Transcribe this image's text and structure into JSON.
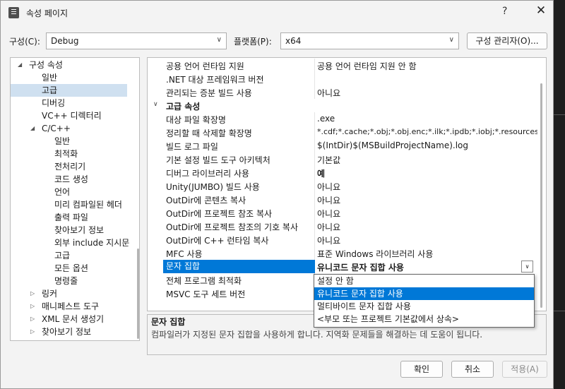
{
  "window": {
    "title": "속성 페이지",
    "help": "?",
    "close": "✕"
  },
  "toolbar": {
    "config_label": "구성(C):",
    "config_value": "Debug",
    "platform_label": "플랫폼(P):",
    "platform_value": "x64",
    "config_manager": "구성 관리자(O)..."
  },
  "tree": {
    "items": [
      {
        "label": "구성 속성",
        "caret": "◢"
      },
      {
        "label": "일반"
      },
      {
        "label": "고급",
        "selected": true
      },
      {
        "label": "디버깅"
      },
      {
        "label": "VC++ 디렉터리"
      },
      {
        "label": "C/C++",
        "caret": "◢"
      },
      {
        "label": "일반"
      },
      {
        "label": "최적화"
      },
      {
        "label": "전처리기"
      },
      {
        "label": "코드 생성"
      },
      {
        "label": "언어"
      },
      {
        "label": "미리 컴파일된 헤더"
      },
      {
        "label": "출력 파일"
      },
      {
        "label": "찾아보기 정보"
      },
      {
        "label": "외부 include 지시문"
      },
      {
        "label": "고급"
      },
      {
        "label": "모든 옵션"
      },
      {
        "label": "명령줄"
      },
      {
        "label": "링커",
        "caret": "▷"
      },
      {
        "label": "매니페스트 도구",
        "caret": "▷"
      },
      {
        "label": "XML 문서 생성기",
        "caret": "▷"
      },
      {
        "label": "찾아보기 정보",
        "caret": "▷"
      }
    ]
  },
  "grid": {
    "rows": [
      {
        "name": "공용 언어 런타임 지원",
        "value": "공용 언어 런타임 지원 안 함"
      },
      {
        "name": ".NET 대상 프레임워크 버전",
        "value": ""
      },
      {
        "name": "관리되는 증분 빌드 사용",
        "value": "아니요"
      },
      {
        "name": "고급 속성",
        "value": "",
        "section": true,
        "chev": "∨"
      },
      {
        "name": "대상 파일 확장명",
        "value": ".exe"
      },
      {
        "name": "정리할 때 삭제할 확장명",
        "value": "*.cdf;*.cache;*.obj;*.obj.enc;*.ilk;*.ipdb;*.iobj;*.resources;*.t"
      },
      {
        "name": "빌드 로그 파일",
        "value": "$(IntDir)$(MSBuildProjectName).log"
      },
      {
        "name": "기본 설정 빌드 도구 아키텍처",
        "value": "기본값"
      },
      {
        "name": "디버그 라이브러리 사용",
        "value": "예",
        "bold": true
      },
      {
        "name": "Unity(JUMBO) 빌드 사용",
        "value": "아니요"
      },
      {
        "name": "OutDir에 콘텐츠 복사",
        "value": "아니요"
      },
      {
        "name": "OutDir에 프로젝트 참조 복사",
        "value": "아니요"
      },
      {
        "name": "OutDir에 프로젝트 참조의 기호 복사",
        "value": "아니요"
      },
      {
        "name": "OutDir에 C++ 런타임 복사",
        "value": "아니요"
      },
      {
        "name": "MFC 사용",
        "value": "표준 Windows 라이브러리 사용"
      },
      {
        "name": "문자 집합",
        "value": "유니코드 문자 집합 사용",
        "selected": true,
        "bold": true,
        "dropdown": "∨"
      },
      {
        "name": "전체 프로그램 최적화",
        "value": ""
      },
      {
        "name": "MSVC 도구 세트 버전",
        "value": ""
      }
    ]
  },
  "dropdown_options": [
    {
      "label": "설정 안 함"
    },
    {
      "label": "유니코드 문자 집합 사용",
      "highlighted": true
    },
    {
      "label": "멀티바이트 문자 집합 사용"
    },
    {
      "label": "<부모 또는 프로젝트 기본값에서 상속>"
    }
  ],
  "description": {
    "title": "문자 집합",
    "text": "컴파일러가 지정된 문자 집합을 사용하게 합니다. 지역화 문제들을 해결하는 데 도움이 됩니다."
  },
  "footer": {
    "ok": "확인",
    "cancel": "취소",
    "apply": "적용(A)"
  },
  "icons": {
    "combo_arrow": "∨",
    "tree_expanded": "◢",
    "tree_collapsed": "▷"
  }
}
